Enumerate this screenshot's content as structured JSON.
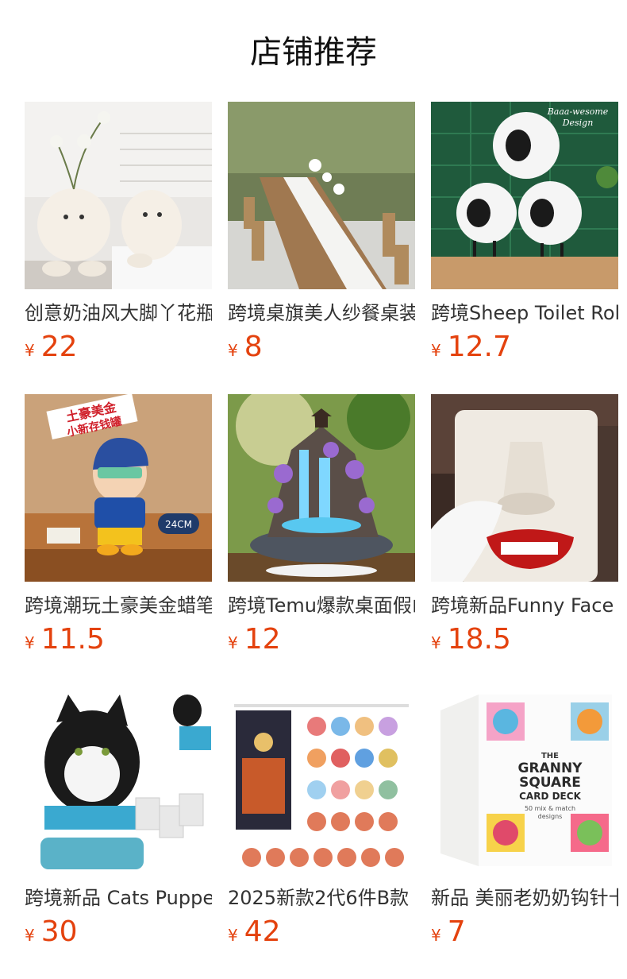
{
  "section_title": "店铺推荐",
  "currency_symbol": "¥",
  "accent_color": "#e4420e",
  "products": [
    {
      "name": "创意奶油风大脚丫花瓶",
      "price": "22",
      "image": "cream-vase-image"
    },
    {
      "name": "跨境桌旗美人纱餐桌装饰",
      "price": "8",
      "image": "table-runner-image"
    },
    {
      "name": "跨境Sheep Toilet Roll Holder",
      "price": "12.7",
      "image": "sheep-toilet-roll-image"
    },
    {
      "name": "跨境潮玩土豪美金蜡笔小新",
      "price": "11.5",
      "image": "crayon-figure-image"
    },
    {
      "name": "跨境Temu爆款桌面假山流水",
      "price": "12",
      "image": "waterfall-fountain-image"
    },
    {
      "name": "跨境新品Funny Face Tissue Holder",
      "price": "18.5",
      "image": "nose-tissue-holder-image"
    },
    {
      "name": "跨境新品 Cats Puppet Toy",
      "price": "30",
      "image": "cat-puppet-image"
    },
    {
      "name": "2025新款2代6件B款",
      "price": "42",
      "image": "acrylic-keychain-image"
    },
    {
      "name": "新品 美丽老奶奶钩针卡片",
      "price": "7",
      "image": "granny-square-deck-image"
    }
  ],
  "granny_deck_text": {
    "line1": "THE",
    "line2": "GRANNY",
    "line3": "SQUARE",
    "line4": "CARD DECK",
    "line5": "50 mix & match",
    "line6": "designs"
  },
  "sheep_text": {
    "line1": "Baaa-wesome",
    "line2": "Design"
  },
  "crayon_text": {
    "line1": "土豪美金",
    "line2": "小新存钱罐",
    "size": "24CM"
  }
}
